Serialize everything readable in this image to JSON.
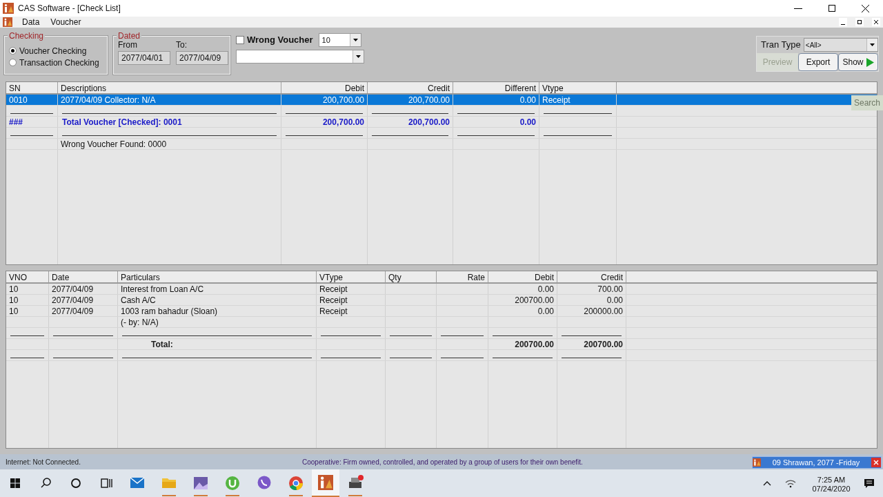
{
  "window": {
    "title": "CAS Software - [Check List]"
  },
  "menu": [
    "Data",
    "Voucher"
  ],
  "checking": {
    "title": "Checking",
    "options": [
      {
        "label": "Voucher Checking",
        "selected": true
      },
      {
        "label": "Transaction Checking",
        "selected": false
      }
    ]
  },
  "dated": {
    "title": "Dated",
    "from_label": "From",
    "from": "2077/04/01",
    "to_label": "To:",
    "to": "2077/04/09"
  },
  "wrong_voucher": {
    "label": "Wrong Voucher",
    "checked": false,
    "count": "10"
  },
  "tran_type": {
    "label": "Tran Type",
    "value": "<All>"
  },
  "buttons": [
    {
      "label": "Preview",
      "disabled": true
    },
    {
      "label": "Export",
      "disabled": false
    },
    {
      "label": "Show",
      "disabled": false
    }
  ],
  "search_button": "Search",
  "summary_table": {
    "columns": [
      "SN",
      "Descriptions",
      "Debit",
      "Credit",
      "Different",
      "Vtype"
    ],
    "rows": [
      {
        "kind": "data",
        "selected": true,
        "cells": [
          "0010",
          "2077/04/09 Collector: N/A",
          "200,700.00",
          "200,700.00",
          "0.00",
          "Receipt"
        ]
      },
      {
        "kind": "rule"
      },
      {
        "kind": "total",
        "cells": [
          "###",
          "Total Voucher [Checked]: 0001",
          "200,700.00",
          "200,700.00",
          "0.00",
          ""
        ]
      },
      {
        "kind": "rule"
      },
      {
        "kind": "note",
        "cells": [
          "",
          "Wrong Voucher Found: 0000",
          "",
          "",
          "",
          ""
        ]
      }
    ]
  },
  "detail_table": {
    "columns": [
      "VNO",
      "Date",
      "Particulars",
      "VType",
      "Qty",
      "Rate",
      "Debit",
      "Credit"
    ],
    "rows": [
      {
        "kind": "data",
        "cells": [
          "10",
          "2077/04/09",
          "Interest from Loan A/C",
          "Receipt",
          "",
          "",
          "0.00",
          "700.00"
        ]
      },
      {
        "kind": "data",
        "cells": [
          "10",
          "2077/04/09",
          "Cash A/C",
          "Receipt",
          "",
          "",
          "200700.00",
          "0.00"
        ]
      },
      {
        "kind": "data",
        "cells": [
          "10",
          "2077/04/09",
          "1003 ram bahadur (Sloan)",
          "Receipt",
          "",
          "",
          "0.00",
          "200000.00"
        ]
      },
      {
        "kind": "data",
        "cells": [
          "",
          "",
          "(- by: N/A)",
          "",
          "",
          "",
          "",
          ""
        ]
      },
      {
        "kind": "rule"
      },
      {
        "kind": "total",
        "cells": [
          "",
          "",
          "Total:",
          "",
          "",
          "",
          "200700.00",
          "200700.00"
        ]
      },
      {
        "kind": "rule"
      }
    ]
  },
  "status_bar": {
    "connection": "Internet: Not Connected.",
    "message": "Cooperative: Firm owned, controlled, and operated by a group of users for their own benefit."
  },
  "date_popup": "09 Shrawan, 2077 -Friday",
  "taskbar": {
    "time": "7:25 AM",
    "date": "07/24/2020"
  }
}
